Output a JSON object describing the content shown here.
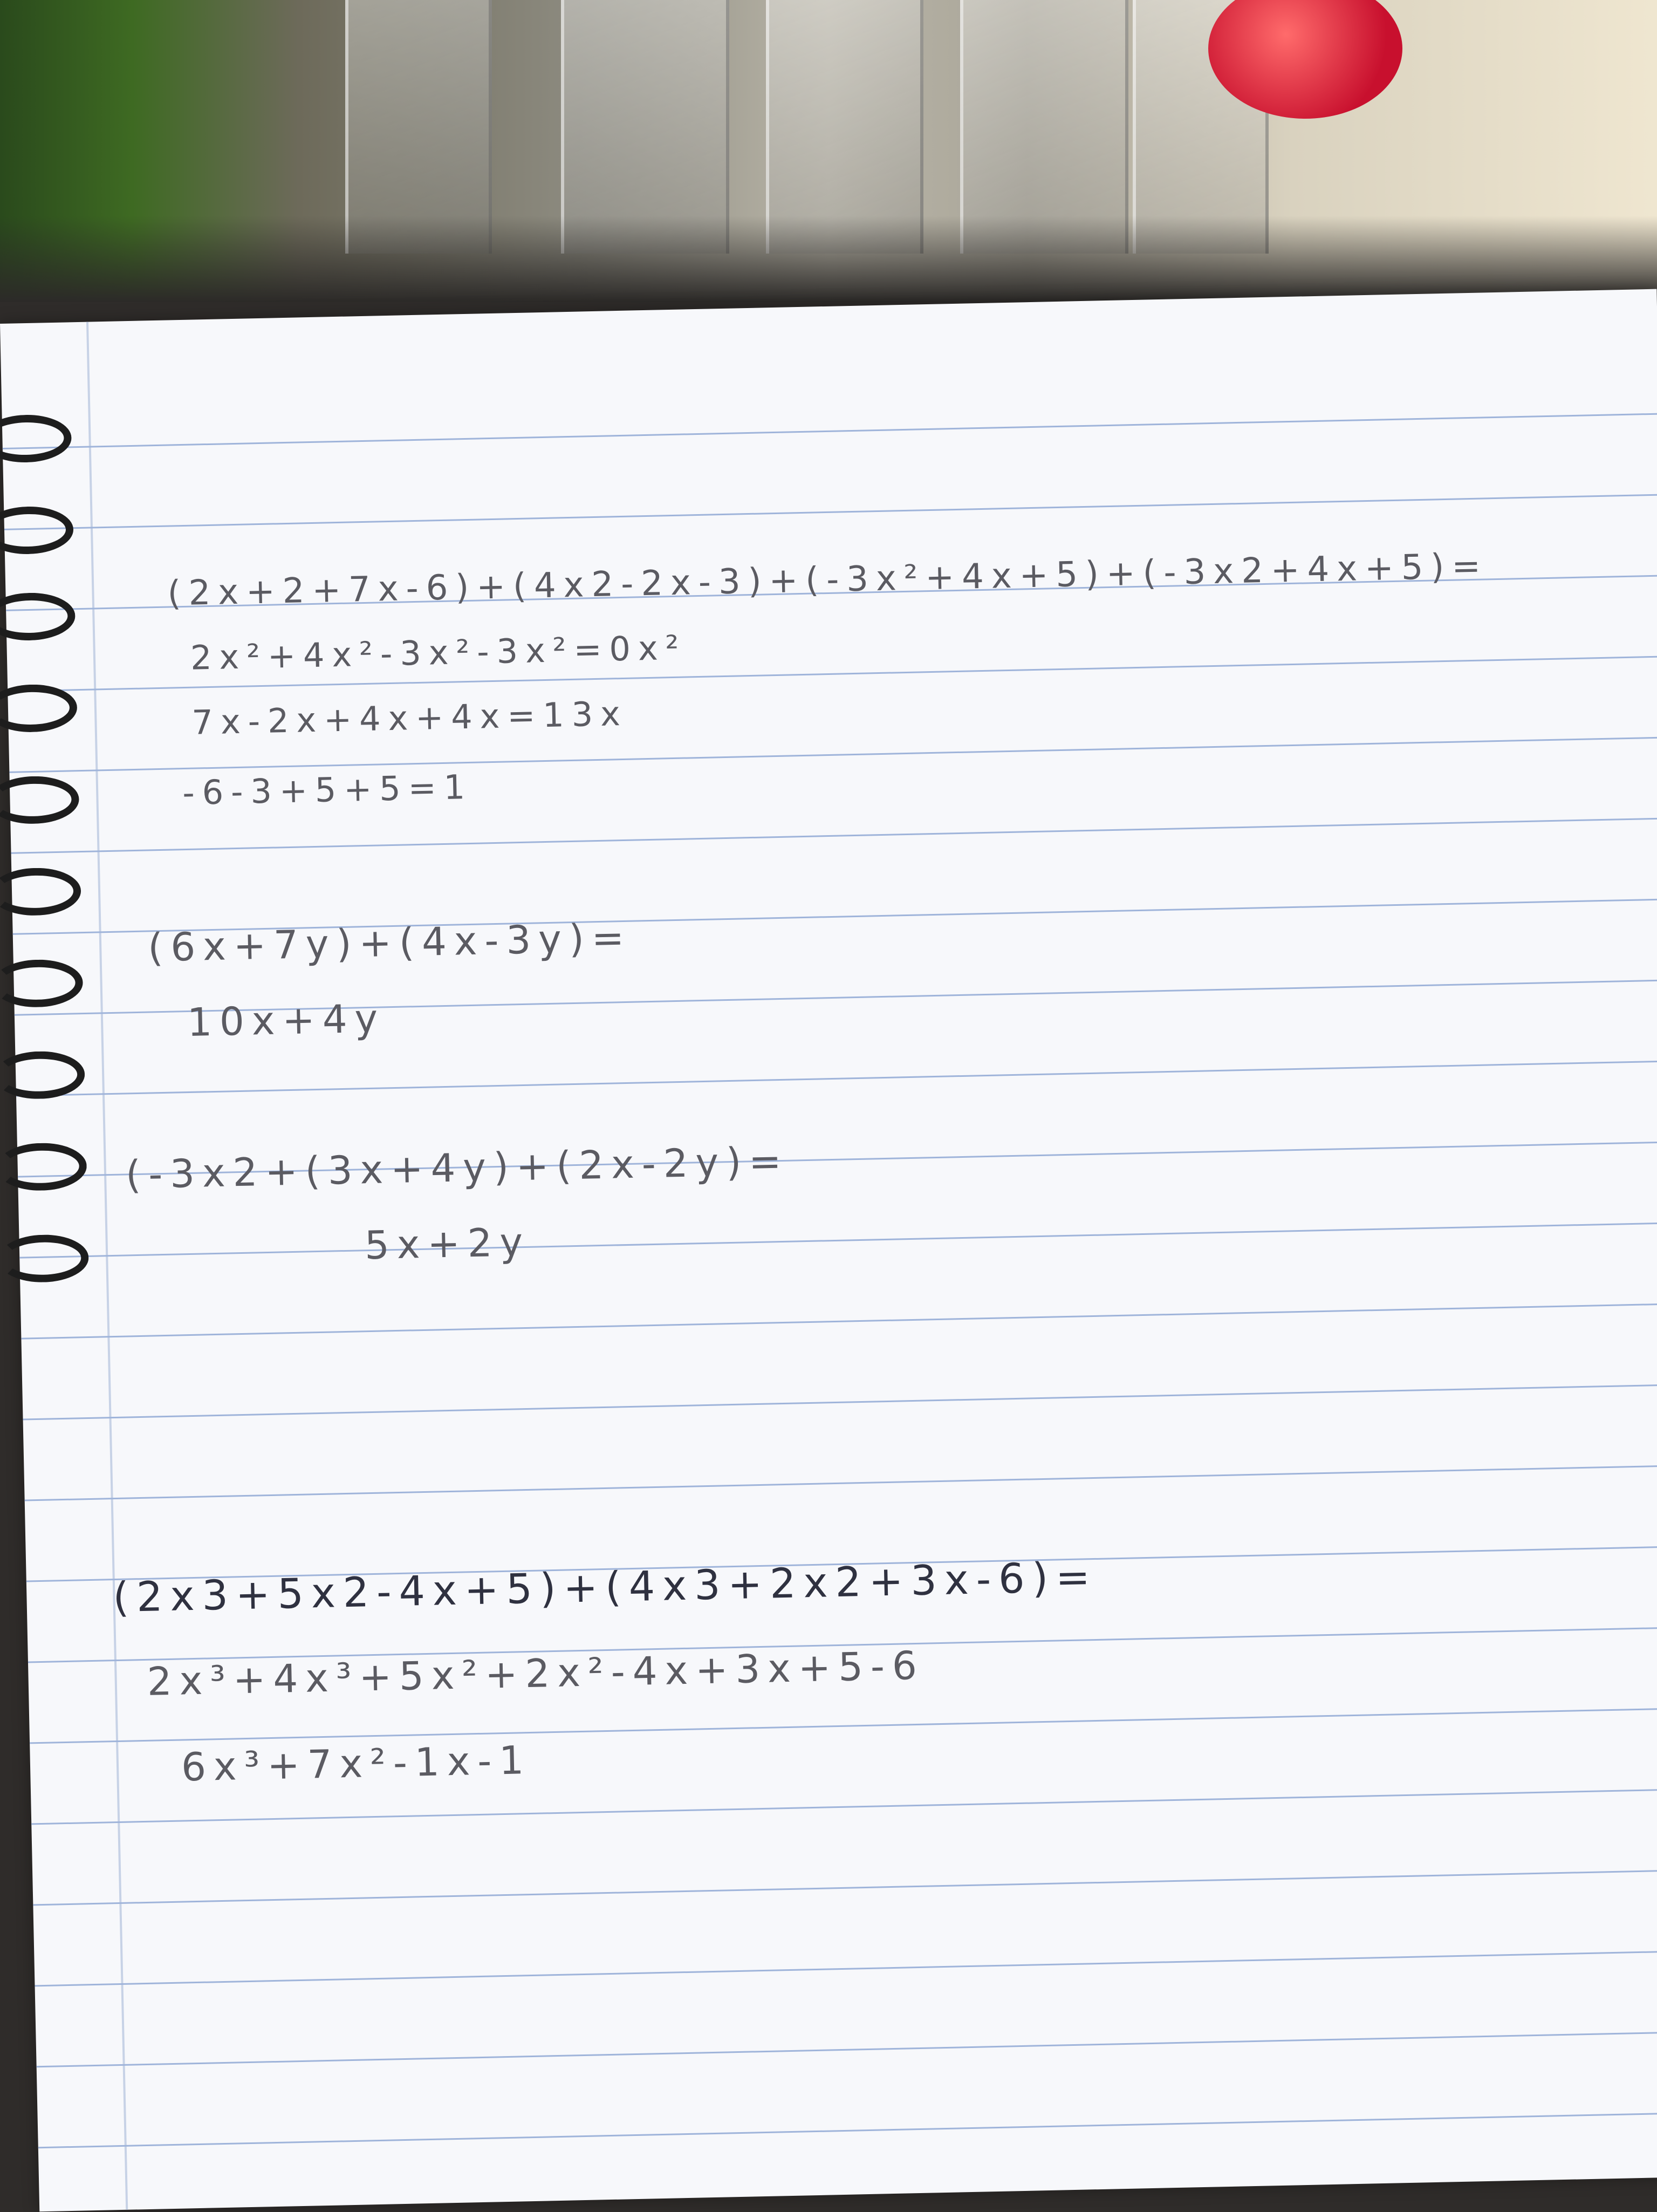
{
  "scene": {
    "description_colors": {
      "paper": "#f7f8fb",
      "rule_line": "#9fb4da",
      "ink_pencil": "#5b5b62",
      "ink_dark": "#2f3140",
      "spiral": "#1d1d1d"
    }
  },
  "problems": [
    {
      "lines": [
        "(2x+2+7x-6)+(4x2-2x-3)+(-3x²+4x+5)+(-3x2+4x+5)=",
        "2x²+4x²-3x²-3x²=0x²",
        "7x-2x+4x+4x=13x",
        "-6-3+5+5=1"
      ]
    },
    {
      "lines": [
        "(6x+7y)+(4x-3y)=",
        "10x+4y"
      ]
    },
    {
      "lines": [
        "(-3x2+(3x+4y)+(2x-2y)=",
        "5x+2y"
      ]
    },
    {
      "lines": [
        "(2x3+5x2-4x+5)+(4x3+2x2+3x-6)=",
        "2x³+4x³+5x²+2x²-4x+3x+5-6",
        "6x³+7x²-1x-1"
      ]
    }
  ]
}
